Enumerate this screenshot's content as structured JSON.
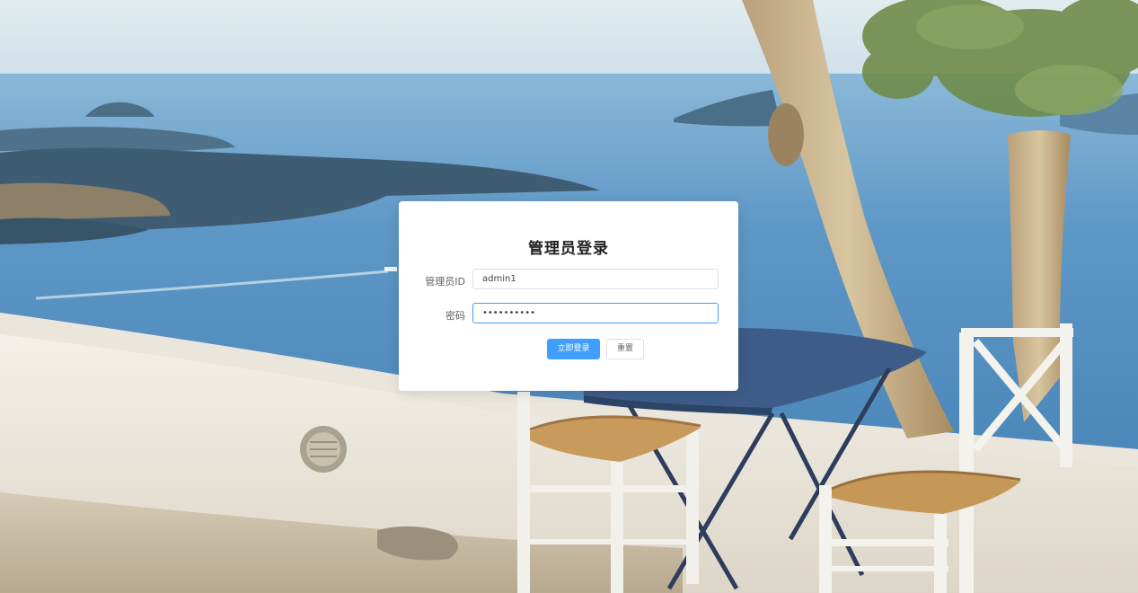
{
  "login": {
    "title": "管理员登录",
    "id_label": "管理员ID",
    "id_value": "admin1",
    "password_label": "密码",
    "password_value": "••••••••••",
    "submit_label": "立即登录",
    "reset_label": "重置"
  },
  "colors": {
    "primary": "#409eff",
    "border": "#dcdfe6",
    "label": "#606266"
  }
}
